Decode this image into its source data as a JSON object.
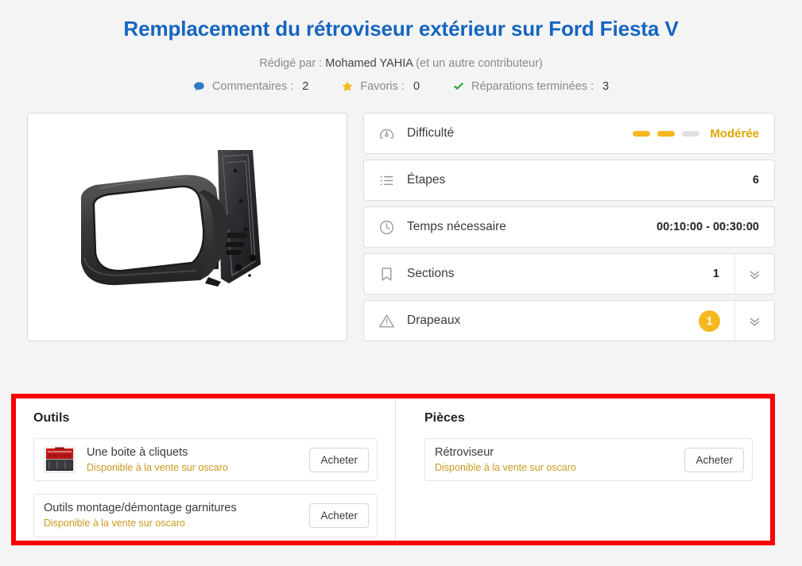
{
  "header": {
    "title": "Remplacement du rétroviseur extérieur sur Ford Fiesta V",
    "byline_prefix": "Rédigé par :",
    "author": "Mohamed YAHIA",
    "byline_suffix": "(et un autre contributeur)",
    "stats": [
      {
        "icon": "comment-icon",
        "label": "Commentaires :",
        "value": "2",
        "color": "#2e7bc4"
      },
      {
        "icon": "star-icon",
        "label": "Favoris :",
        "value": "0",
        "color": "#f5b820"
      },
      {
        "icon": "check-icon",
        "label": "Réparations terminées :",
        "value": "3",
        "color": "#35a235"
      }
    ]
  },
  "photo": {
    "alt": "Rétroviseur extérieur noir vu de profil"
  },
  "info_panel": {
    "rows": [
      {
        "icon": "gauge-icon",
        "label": "Difficulté",
        "kind": "difficulty",
        "value": "Modérée",
        "segments_total": 3,
        "segments_filled": 2,
        "filled_color": "#f5b820",
        "empty_color": "#e0e0e0"
      },
      {
        "icon": "list-icon",
        "label": "Étapes",
        "kind": "value",
        "value": "6"
      },
      {
        "icon": "clock-icon",
        "label": "Temps nécessaire",
        "kind": "value",
        "value": "00:10:00 - 00:30:00"
      },
      {
        "icon": "bookmark-icon",
        "label": "Sections",
        "kind": "value-expand",
        "value": "1"
      },
      {
        "icon": "warning-icon",
        "label": "Drapeaux",
        "kind": "badge-expand",
        "value": "1",
        "badge_color": "#f5b820"
      }
    ]
  },
  "supplies": {
    "highlight_color": "#fb0000",
    "tools": {
      "title": "Outils",
      "items": [
        {
          "name": "Une boite à cliquets",
          "availability": "Disponible à la vente sur oscaro",
          "thumbnail": "toolbox-thumbnail",
          "buy_label": "Acheter"
        },
        {
          "name": "Outils montage/démontage garnitures",
          "availability": "Disponible à la vente sur oscaro",
          "thumbnail": null,
          "buy_label": "Acheter"
        }
      ]
    },
    "parts": {
      "title": "Pièces",
      "items": [
        {
          "name": "Rétroviseur",
          "availability": "Disponible à la vente sur oscaro",
          "thumbnail": null,
          "buy_label": "Acheter"
        }
      ]
    }
  }
}
